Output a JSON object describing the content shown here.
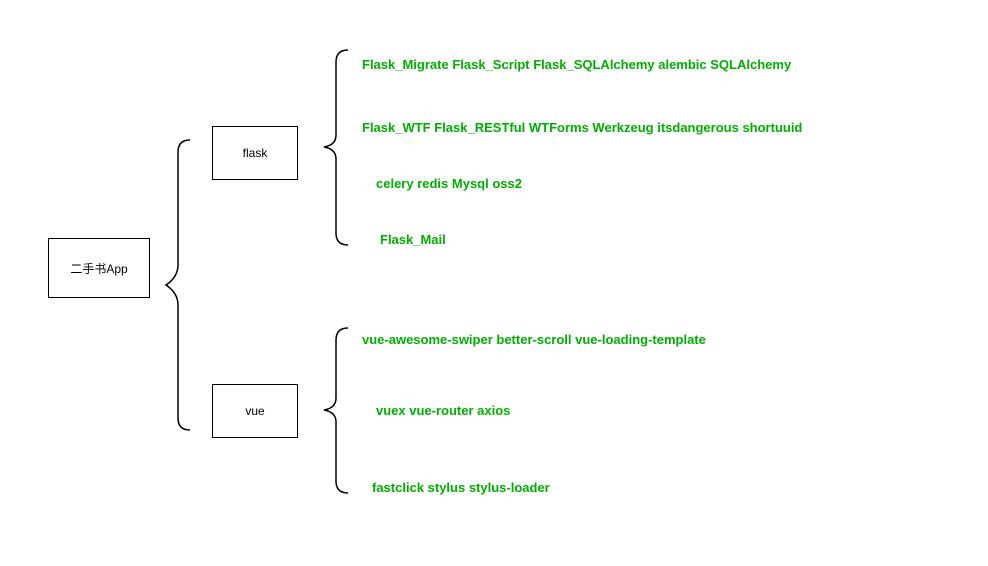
{
  "chart_data": {
    "type": "tree",
    "root": {
      "name": "二手书App",
      "children": [
        {
          "name": "flask",
          "children": [
            {
              "name": "Flask_Migrate Flask_Script Flask_SQLAlchemy alembic SQLAlchemy"
            },
            {
              "name": "Flask_WTF Flask_RESTful WTForms Werkzeug itsdangerous shortuuid"
            },
            {
              "name": "celery redis Mysql oss2"
            },
            {
              "name": "Flask_Mail"
            }
          ]
        },
        {
          "name": "vue",
          "children": [
            {
              "name": "vue-awesome-swiper better-scroll vue-loading-template"
            },
            {
              "name": "vuex vue-router axios"
            },
            {
              "name": "fastclick stylus stylus-loader"
            }
          ]
        }
      ]
    }
  },
  "root": {
    "label": "二手书App"
  },
  "mid": {
    "flask": {
      "label": "flask"
    },
    "vue": {
      "label": "vue"
    }
  },
  "leaves": {
    "flask1": "Flask_Migrate   Flask_Script  Flask_SQLAlchemy  alembic  SQLAlchemy",
    "flask2": "Flask_WTF  Flask_RESTful  WTForms  Werkzeug  itsdangerous   shortuuid",
    "flask3": "celery  redis  Mysql  oss2",
    "flask4": "Flask_Mail",
    "vue1": "vue-awesome-swiper  better-scroll   vue-loading-template",
    "vue2": "vuex    vue-router  axios",
    "vue3": "fastclick   stylus    stylus-loader"
  }
}
